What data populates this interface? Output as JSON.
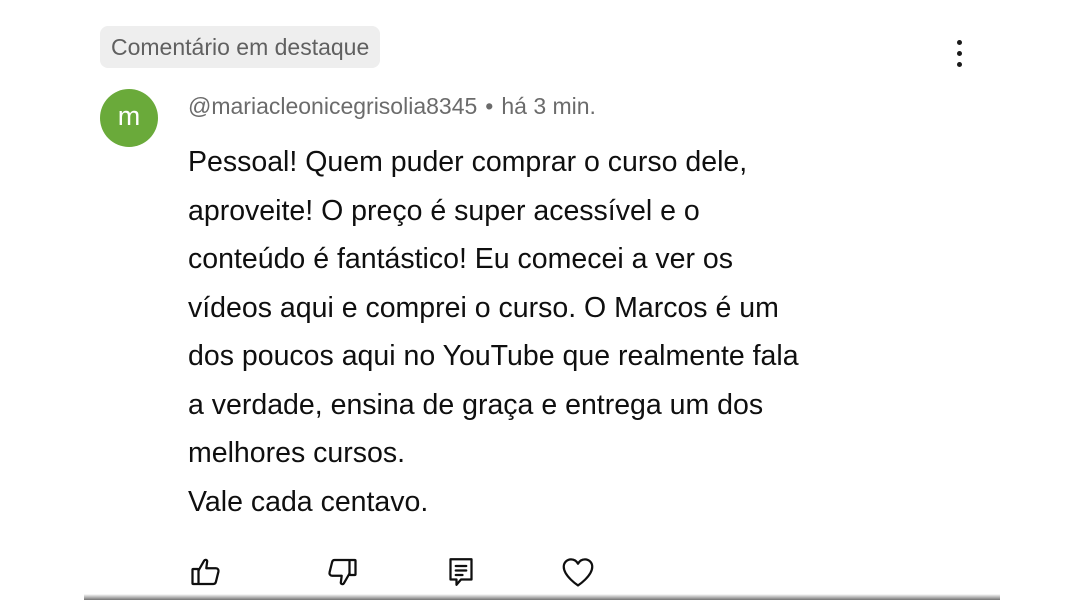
{
  "pinned_label": "Comentário em destaque",
  "comment": {
    "avatar_letter": "m",
    "author": "@mariacleonicegrisolia8345",
    "separator": "•",
    "timestamp": "há 3 min.",
    "lines": [
      "Pessoal! Quem puder comprar o curso dele,",
      "aproveite! O preço é super acessível e o",
      "conteúdo é fantástico! Eu comecei a ver os",
      "vídeos aqui e comprei o curso. O Marcos é um",
      "dos poucos aqui no YouTube que realmente fala",
      "a verdade, ensina de graça e entrega um dos",
      "melhores cursos.",
      "Vale cada centavo."
    ]
  },
  "actions": [
    {
      "icon": "thumbs-up-icon"
    },
    {
      "icon": "thumbs-down-icon"
    },
    {
      "icon": "reply-comment-icon"
    },
    {
      "icon": "heart-icon"
    }
  ],
  "colors": {
    "avatar_bg": "#6aaa3a",
    "pinned_bg": "#eeeeee",
    "meta_text": "#6b6b6b",
    "body_text": "#0f0f0f"
  }
}
